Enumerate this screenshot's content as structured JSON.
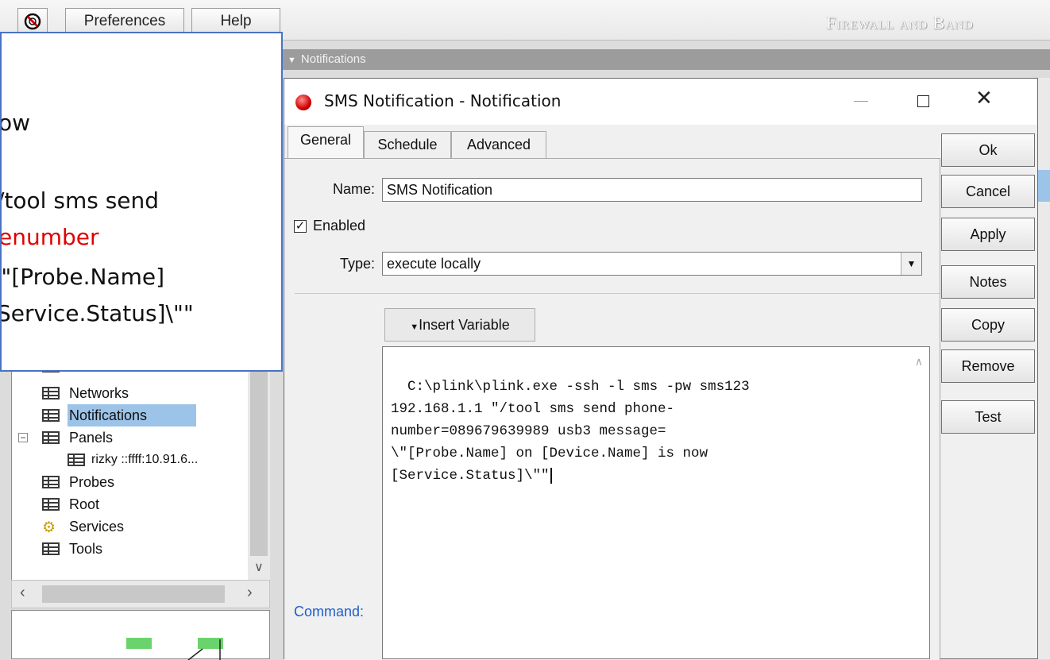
{
  "toolbar": {
    "preferences_label": "Preferences",
    "help_label": "Help",
    "brand": "Firewall and Band"
  },
  "notifications_bar": {
    "label": "Notifications"
  },
  "callout": {
    "lines": [
      "ow",
      "/tool sms send",
      "enumber",
      "\\\"[Probe.Name]",
      "Service.Status]\\\"\""
    ]
  },
  "tree": {
    "items": [
      {
        "label": "Networks"
      },
      {
        "label": "Notifications"
      },
      {
        "label": "Panels"
      },
      {
        "label": "rizky ::ffff:10.91.6..."
      },
      {
        "label": "Probes"
      },
      {
        "label": "Root"
      },
      {
        "label": "Services"
      },
      {
        "label": "Tools"
      }
    ]
  },
  "dialog": {
    "title": "SMS Notification - Notification",
    "tabs": [
      {
        "label": "General"
      },
      {
        "label": "Schedule"
      },
      {
        "label": "Advanced"
      }
    ],
    "name_label": "Name:",
    "name_value": "SMS Notification",
    "enabled_label": "Enabled",
    "enabled_checked": true,
    "type_label": "Type:",
    "type_value": "execute locally",
    "insert_variable_label": "Insert Variable",
    "command_label": "Command:",
    "command_value": "C:\\plink\\plink.exe -ssh -l sms -pw sms123\n192.168.1.1 \"/tool sms send phone-\nnumber=089679639989 usb3 message=\n\\\"[Probe.Name] on [Device.Name] is now\n[Service.Status]\\\"\"",
    "buttons": {
      "ok": "Ok",
      "cancel": "Cancel",
      "apply": "Apply",
      "notes": "Notes",
      "copy": "Copy",
      "remove": "Remove",
      "test": "Test"
    }
  },
  "colors": {
    "accent_red": "#e00000",
    "callout_border": "#4a73c4",
    "selection": "#9cc3e8",
    "command_label": "#1f5fc7"
  }
}
